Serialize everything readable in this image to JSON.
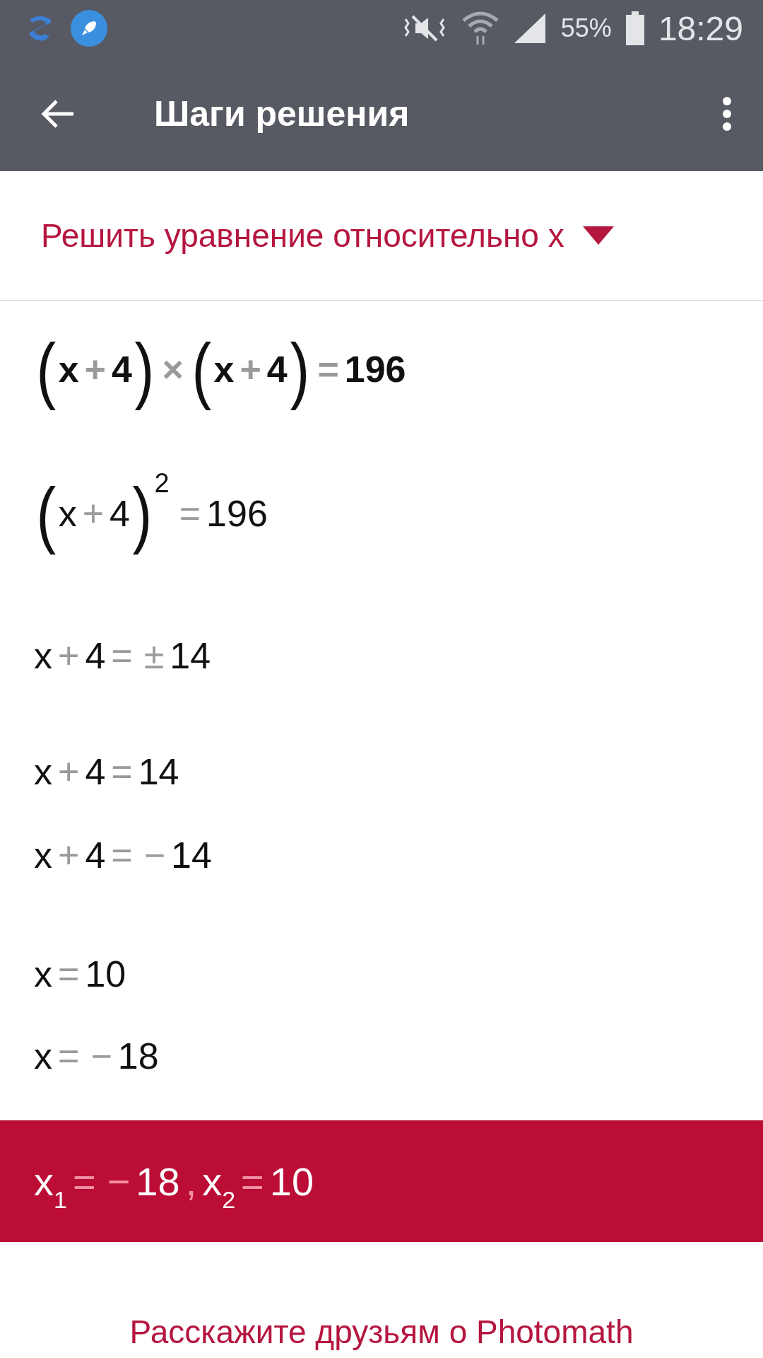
{
  "status_bar": {
    "battery": "55%",
    "time": "18:29"
  },
  "app_bar": {
    "title": "Шаги решения"
  },
  "method": {
    "label": "Решить уравнение относительно x",
    "expanded": false
  },
  "steps": [
    {
      "bold": true,
      "tokens": [
        {
          "t": "(",
          "kind": "paren"
        },
        {
          "t": "x",
          "kind": "term"
        },
        {
          "t": "+",
          "kind": "op"
        },
        {
          "t": "4",
          "kind": "term"
        },
        {
          "t": ")",
          "kind": "paren"
        },
        {
          "t": "×",
          "kind": "op"
        },
        {
          "t": "(",
          "kind": "paren"
        },
        {
          "t": "x",
          "kind": "term"
        },
        {
          "t": "+",
          "kind": "op"
        },
        {
          "t": "4",
          "kind": "term"
        },
        {
          "t": ")",
          "kind": "paren"
        },
        {
          "t": "=",
          "kind": "op"
        },
        {
          "t": "196",
          "kind": "term"
        }
      ]
    },
    {
      "bold": false,
      "tokens": [
        {
          "t": "(",
          "kind": "paren"
        },
        {
          "t": "x",
          "kind": "term"
        },
        {
          "t": "+",
          "kind": "op"
        },
        {
          "t": "4",
          "kind": "term"
        },
        {
          "t": ")",
          "kind": "paren"
        },
        {
          "t": "2",
          "kind": "sup"
        },
        {
          "t": "=",
          "kind": "op"
        },
        {
          "t": "196",
          "kind": "term"
        }
      ]
    },
    {
      "bold": false,
      "tokens": [
        {
          "t": "x",
          "kind": "term"
        },
        {
          "t": "+",
          "kind": "op"
        },
        {
          "t": "4",
          "kind": "term"
        },
        {
          "t": "=",
          "kind": "op"
        },
        {
          "t": "±",
          "kind": "op"
        },
        {
          "t": "14",
          "kind": "term"
        }
      ]
    },
    {
      "bold": false,
      "tokens": [
        {
          "t": "x",
          "kind": "term"
        },
        {
          "t": "+",
          "kind": "op"
        },
        {
          "t": "4",
          "kind": "term"
        },
        {
          "t": "=",
          "kind": "op"
        },
        {
          "t": "14",
          "kind": "term"
        }
      ]
    },
    {
      "bold": false,
      "tokens": [
        {
          "t": "x",
          "kind": "term"
        },
        {
          "t": "+",
          "kind": "op"
        },
        {
          "t": "4",
          "kind": "term"
        },
        {
          "t": "=",
          "kind": "op"
        },
        {
          "t": "−",
          "kind": "op"
        },
        {
          "t": "14",
          "kind": "term"
        }
      ]
    },
    {
      "bold": false,
      "tokens": [
        {
          "t": "x",
          "kind": "term"
        },
        {
          "t": "=",
          "kind": "op"
        },
        {
          "t": "10",
          "kind": "term"
        }
      ]
    },
    {
      "bold": false,
      "tokens": [
        {
          "t": "x",
          "kind": "term"
        },
        {
          "t": "=",
          "kind": "op"
        },
        {
          "t": "−",
          "kind": "op"
        },
        {
          "t": "18",
          "kind": "term"
        }
      ]
    }
  ],
  "answer": {
    "tokens": [
      {
        "t": "x",
        "kind": "term"
      },
      {
        "t": "1",
        "kind": "sub"
      },
      {
        "t": "=",
        "kind": "op"
      },
      {
        "t": "−",
        "kind": "op"
      },
      {
        "t": "18",
        "kind": "term"
      },
      {
        "t": ",",
        "kind": "op"
      },
      {
        "t": "x",
        "kind": "term"
      },
      {
        "t": "2",
        "kind": "sub"
      },
      {
        "t": "=",
        "kind": "op"
      },
      {
        "t": "10",
        "kind": "term"
      }
    ]
  },
  "share_link": "Расскажите друзьям о Photomath"
}
